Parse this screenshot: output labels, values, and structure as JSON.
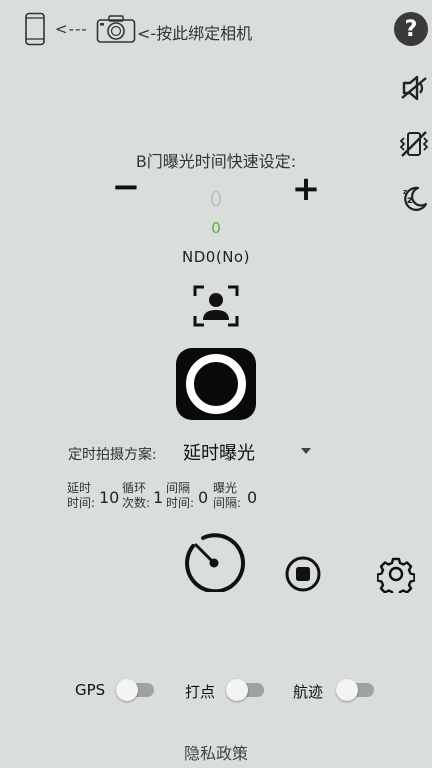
{
  "header": {
    "arrow": "<---",
    "bind_text": "<-按此绑定相机",
    "help": "?"
  },
  "bulb": {
    "title": "B门曝光时间快速设定:",
    "minus": "−",
    "plus": "+",
    "value": "0",
    "secondary_value": "0",
    "nd_label": "ND0(No)"
  },
  "timer_scheme": {
    "label": "定时拍摄方案:",
    "selected": "延时曝光"
  },
  "params": [
    {
      "label_line1": "延时",
      "label_line2": "时间:",
      "value": "10"
    },
    {
      "label_line1": "循环",
      "label_line2": "次数:",
      "value": "1"
    },
    {
      "label_line1": "间隔",
      "label_line2": "时间:",
      "value": "0"
    },
    {
      "label_line1": "曝光",
      "label_line2": "间隔:",
      "value": "0"
    }
  ],
  "toggles": [
    {
      "label": "GPS",
      "on": false
    },
    {
      "label": "打点",
      "on": false
    },
    {
      "label": "航迹",
      "on": false
    }
  ],
  "footer": {
    "privacy": "隐私政策"
  },
  "colors": {
    "background": "#d9dedd",
    "accent_green": "#56b035",
    "shutter": "#0a0a0a"
  },
  "icons": [
    "phone-icon",
    "camera-icon",
    "help-icon",
    "mute-icon",
    "vibrate-off-icon",
    "night-mode-icon",
    "face-frame-icon",
    "timer-icon",
    "stop-icon",
    "gear-icon"
  ]
}
